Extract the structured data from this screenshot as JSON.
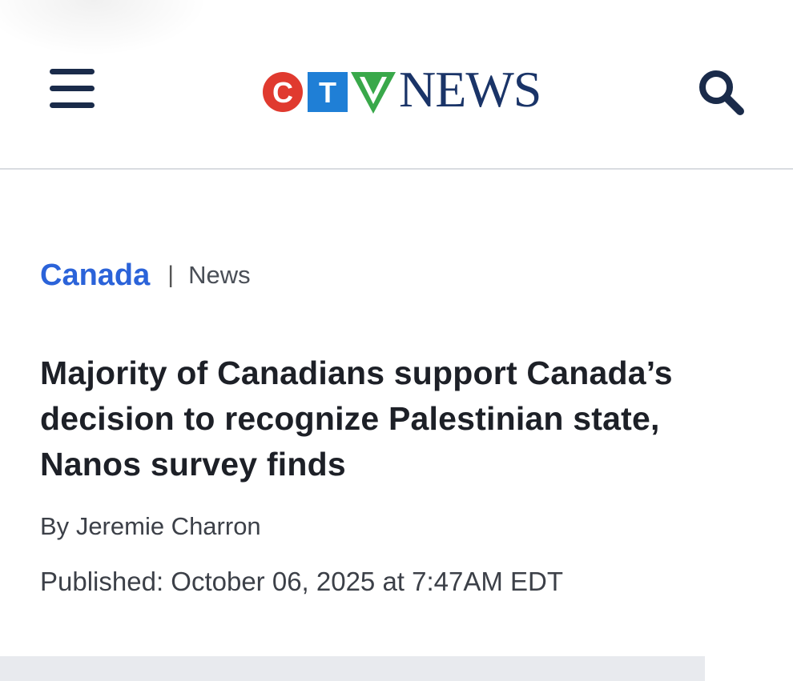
{
  "header": {
    "logo": {
      "letters": [
        "C",
        "T",
        "V"
      ],
      "wordmark": "NEWS",
      "colors": {
        "c": "#e03a2f",
        "t": "#1f7fd6",
        "v": "#39a84a",
        "wordmark": "#1a3468"
      }
    },
    "menu_icon": "hamburger-menu-icon",
    "search_icon": "search-icon",
    "icon_color": "#1a2b4a"
  },
  "breadcrumb": {
    "section": "Canada",
    "separator": "|",
    "type": "News",
    "section_color": "#2b63d9"
  },
  "article": {
    "headline": "Majority of Canadians support Canada’s decision to recognize Palestinian state, Nanos survey finds",
    "byline_prefix": "By",
    "author": "Jeremie Charron",
    "published_label": "Published:",
    "published_date": "October 06, 2025 at 7:47AM EDT"
  }
}
